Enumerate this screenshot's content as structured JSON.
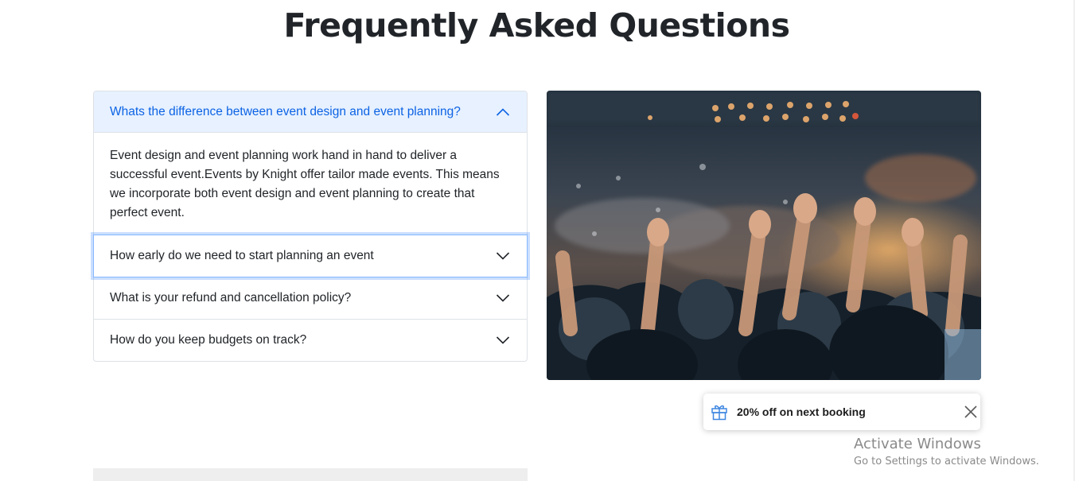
{
  "page": {
    "title": "Frequently Asked Questions"
  },
  "faq": {
    "items": [
      {
        "question": "Whats the difference between event design and event planning?",
        "answer": "Event design and event planning work hand in hand to deliver a successful event.Events by Knight offer tailor made events. This means we incorporate both event design and event planning to create that perfect event.",
        "expanded": true
      },
      {
        "question": "How early do we need to start planning an event",
        "expanded": false,
        "focused": true
      },
      {
        "question": "What is your refund and cancellation policy?",
        "expanded": false
      },
      {
        "question": "How do you keep budgets on track?",
        "expanded": false
      }
    ]
  },
  "image": {
    "subject": "concert crowd with raised hands"
  },
  "promo": {
    "text": "20% off on next booking",
    "icon": "gift-icon",
    "close_icon": "close-icon"
  },
  "windows_watermark": {
    "title": "Activate Windows",
    "subtitle": "Go to Settings to activate Windows."
  },
  "colors": {
    "accent": "#0c63e4",
    "open_bg": "#e7f1ff",
    "border": "#dee2e6",
    "text": "#212529"
  }
}
